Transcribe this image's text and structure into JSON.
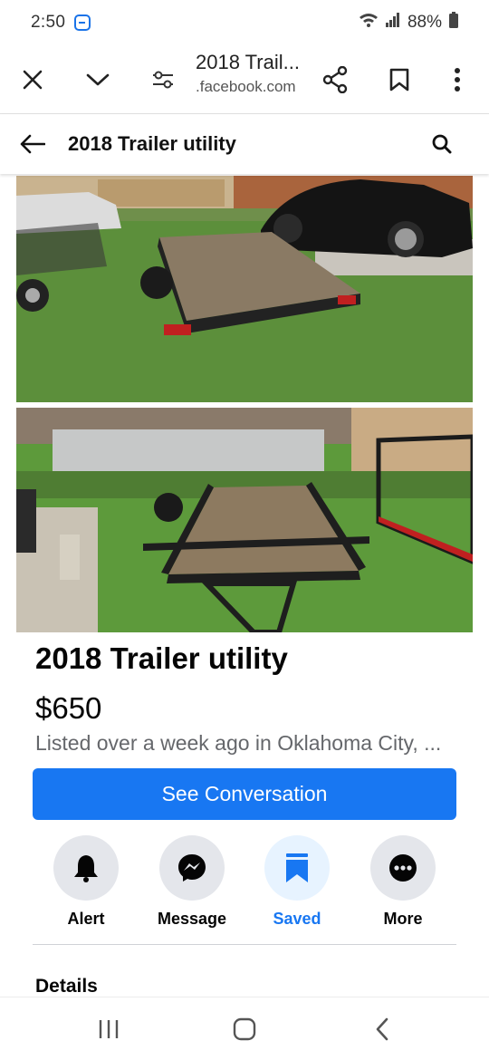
{
  "status_bar": {
    "time": "2:50",
    "battery": "88%",
    "icons": [
      "app-notification-icon",
      "wifi-icon",
      "signal-icon",
      "battery-icon"
    ]
  },
  "browser": {
    "page_title": "2018 Trail...",
    "domain": ".facebook.com",
    "icons": [
      "close-icon",
      "chevron-down-icon",
      "page-settings-icon",
      "share-icon",
      "bookmark-icon",
      "more-vert-icon"
    ]
  },
  "header": {
    "title": "2018 Trailer utility",
    "icons": [
      "back-arrow-icon",
      "search-icon"
    ]
  },
  "listing": {
    "title": "2018 Trailer utility",
    "price": "$650",
    "meta": "Listed over a week ago in Oklahoma City, ...",
    "photos": [
      "trailer-photo-1",
      "trailer-photo-2"
    ]
  },
  "cta": {
    "label": "See Conversation"
  },
  "actions": [
    {
      "label": "Alert",
      "icon": "bell-icon"
    },
    {
      "label": "Message",
      "icon": "messenger-icon"
    },
    {
      "label": "Saved",
      "icon": "bookmark-filled-icon"
    },
    {
      "label": "More",
      "icon": "more-horiz-icon"
    }
  ],
  "details": {
    "heading": "Details"
  },
  "nav": {
    "icons": [
      "recent-apps-icon",
      "home-icon",
      "back-icon"
    ]
  },
  "colors": {
    "brand_blue": "#1877f2",
    "saved_bg": "#e7f3ff",
    "action_bg": "#e4e6eb",
    "meta_gray": "#65676b"
  }
}
